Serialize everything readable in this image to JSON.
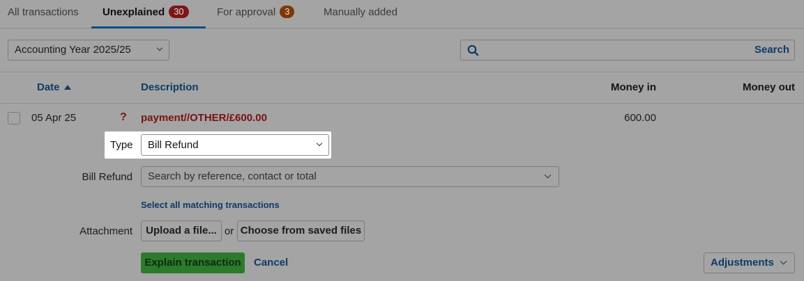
{
  "tabs": [
    {
      "label": "All transactions"
    },
    {
      "label": "Unexplained",
      "badge": "30"
    },
    {
      "label": "For approval",
      "badge": "3"
    },
    {
      "label": "Manually added"
    }
  ],
  "filter": {
    "year_select": "Accounting Year 2025/25"
  },
  "search": {
    "placeholder": "",
    "button_label": "Search"
  },
  "table": {
    "columns": {
      "date": "Date",
      "description": "Description",
      "money_in": "Money in",
      "money_out": "Money out"
    },
    "row": {
      "date": "05 Apr 25",
      "status_icon": "?",
      "description": "payment//OTHER/£600.00",
      "money_in": "600.00",
      "money_out": ""
    }
  },
  "explain_form": {
    "type_label": "Type",
    "type_value": "Bill Refund",
    "bill_refund_label": "Bill Refund",
    "bill_refund_placeholder": "Search by reference, contact or total",
    "select_all_link": "Select all matching transactions",
    "attachment_label": "Attachment",
    "upload_button": "Upload a file...",
    "or_text": "or",
    "saved_files_button": "Choose from saved files",
    "explain_button": "Explain transaction",
    "cancel_link": "Cancel",
    "adjustments_button": "Adjustments"
  },
  "colors": {
    "accent": "#0f3a67",
    "badge_red": "#7a1619",
    "badge_orange": "#7e3708",
    "description": "#7a1212",
    "primary_button": "#2c7a2c"
  }
}
